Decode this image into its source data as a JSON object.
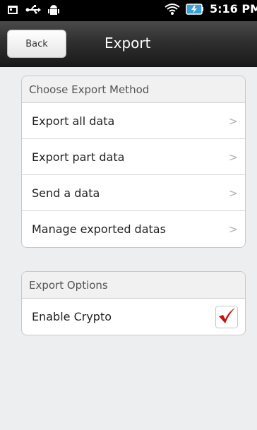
{
  "status_bar": {
    "time": "5:16 PM",
    "icons": [
      "photo-icon",
      "usb-icon",
      "android-icon",
      "wifi-icon",
      "battery-icon"
    ]
  },
  "header": {
    "back_label": "Back",
    "title": "Export"
  },
  "export_method": {
    "header": "Choose Export Method",
    "items": [
      {
        "label": "Export all data"
      },
      {
        "label": "Export part data"
      },
      {
        "label": "Send a data"
      },
      {
        "label": "Manage exported datas"
      }
    ]
  },
  "export_options": {
    "header": "Export Options",
    "items": [
      {
        "label": "Enable Crypto",
        "checked": true
      }
    ]
  },
  "colors": {
    "checkmark": "#cc1111",
    "titlebar": "#2f2f2f"
  }
}
